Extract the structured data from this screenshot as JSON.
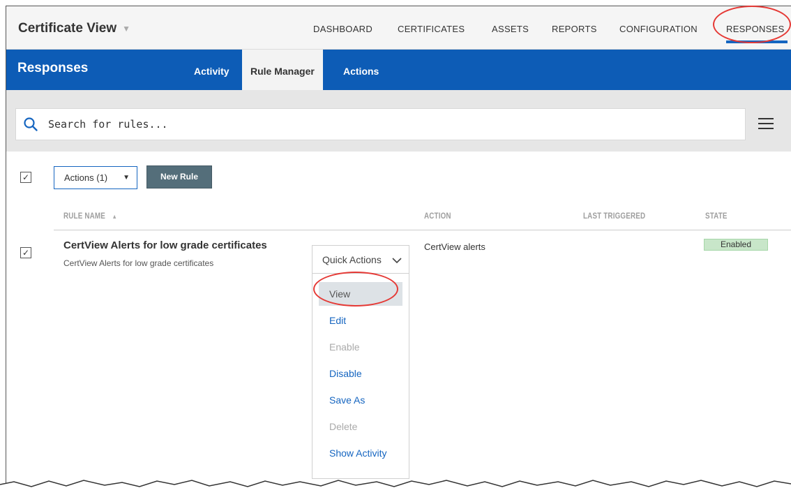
{
  "app": {
    "title": "Certificate View"
  },
  "nav": {
    "items": [
      "DASHBOARD",
      "CERTIFICATES",
      "ASSETS",
      "REPORTS",
      "CONFIGURATION",
      "RESPONSES"
    ],
    "active": "RESPONSES"
  },
  "section": {
    "title": "Responses",
    "tabs": [
      "Activity",
      "Rule Manager",
      "Actions"
    ],
    "active_tab": "Rule Manager"
  },
  "search": {
    "placeholder": "Search for rules..."
  },
  "toolbar": {
    "actions_label": "Actions (1)",
    "new_rule_label": "New Rule"
  },
  "table": {
    "headers": {
      "rule_name": "RULE NAME",
      "action": "ACTION",
      "last_triggered": "LAST TRIGGERED",
      "state": "STATE"
    },
    "rows": [
      {
        "name": "CertView Alerts for low grade certificates",
        "description": "CertView Alerts for low grade certificates",
        "action": "CertView alerts",
        "last_triggered": "",
        "state": "Enabled",
        "checked": true
      }
    ]
  },
  "quick_actions": {
    "label": "Quick Actions",
    "items": [
      {
        "label": "View",
        "state": "hover"
      },
      {
        "label": "Edit",
        "state": "enabled"
      },
      {
        "label": "Enable",
        "state": "disabled"
      },
      {
        "label": "Disable",
        "state": "enabled"
      },
      {
        "label": "Save As",
        "state": "enabled"
      },
      {
        "label": "Delete",
        "state": "disabled"
      },
      {
        "label": "Show Activity",
        "state": "enabled"
      }
    ]
  },
  "colors": {
    "brand_blue": "#0d5cb6",
    "accent_red": "#e53935",
    "enabled_green": "#c8e6c9"
  },
  "icons": {
    "search": "search-icon",
    "menu": "hamburger-menu-icon",
    "sort": "sort-ascending-icon"
  }
}
